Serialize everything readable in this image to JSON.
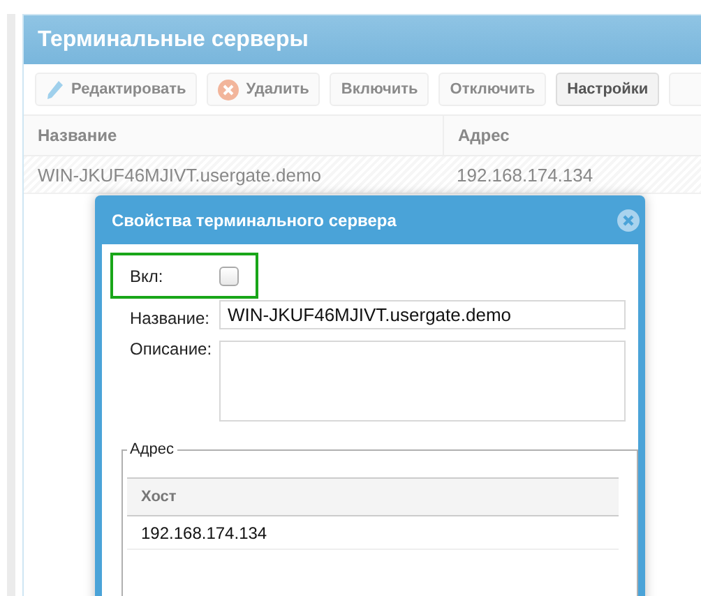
{
  "panel": {
    "title": "Терминальные серверы",
    "toolbar": [
      {
        "label": "Редактировать",
        "kind": "edit",
        "disabled": true
      },
      {
        "label": "Удалить",
        "kind": "delete",
        "disabled": true
      },
      {
        "label": "Включить",
        "kind": "plain",
        "disabled": true
      },
      {
        "label": "Отключить",
        "kind": "plain",
        "disabled": true
      },
      {
        "label": "Настройки",
        "kind": "plain",
        "disabled": false
      }
    ],
    "table": {
      "columns": [
        "Название",
        "Адрес"
      ],
      "rows": [
        [
          "WIN-JKUF46MJIVT.usergate.demo",
          "192.168.174.134"
        ]
      ]
    }
  },
  "dialog": {
    "title": "Свойства терминального сервера",
    "enabled": {
      "label": "Вкл:",
      "checked": false,
      "highlighted": true
    },
    "name": {
      "label": "Название:",
      "value": "WIN-JKUF46MJIVT.usergate.demo"
    },
    "description": {
      "label": "Описание:"
    },
    "address": {
      "legend": "Адрес",
      "columns": [
        "Хост"
      ],
      "rows": [
        [
          "192.168.174.134"
        ]
      ]
    }
  }
}
